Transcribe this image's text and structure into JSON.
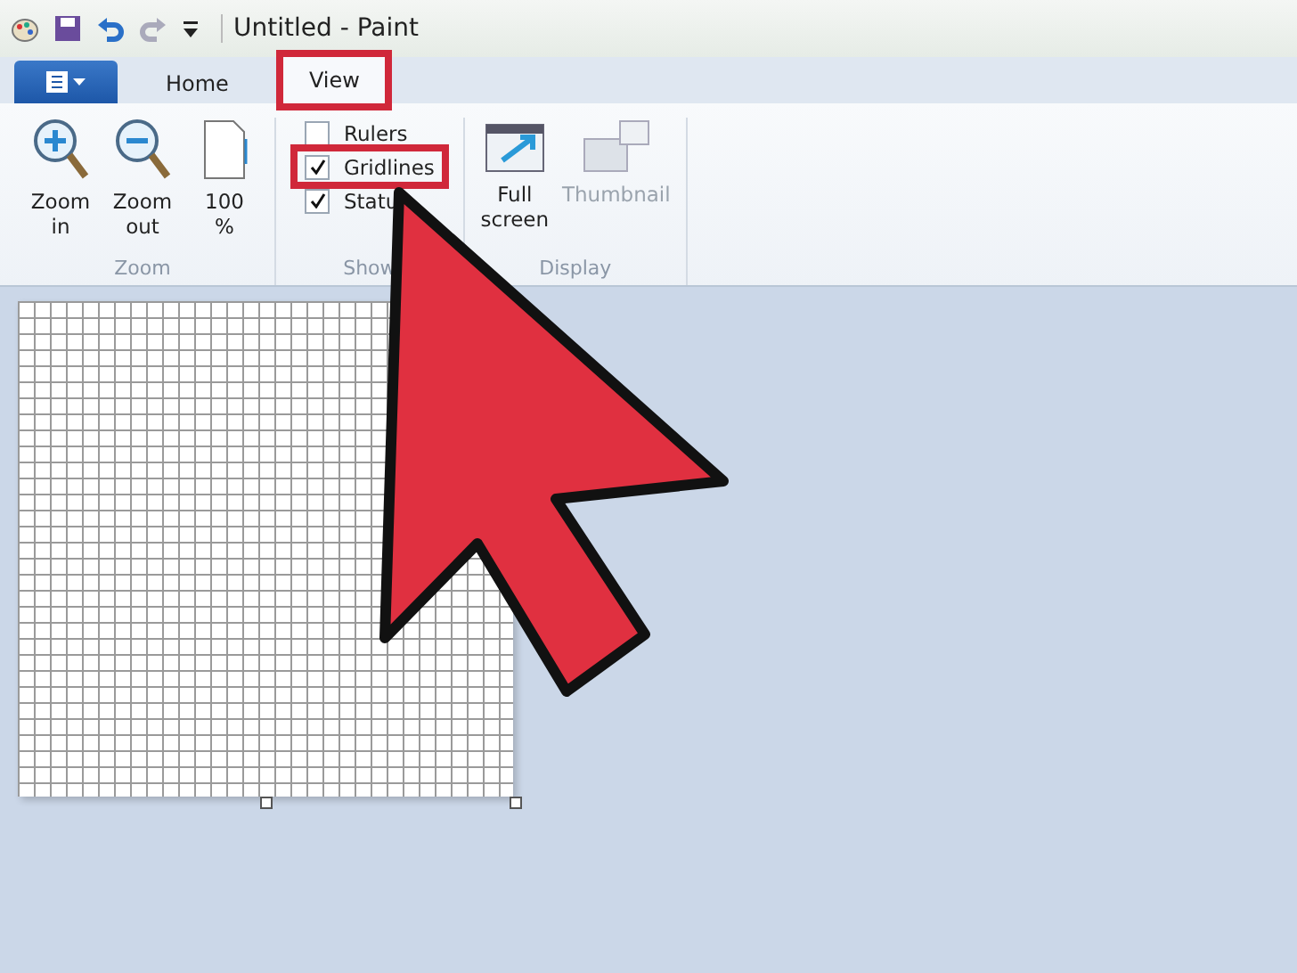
{
  "window": {
    "title": "Untitled - Paint"
  },
  "tabs": [
    {
      "label": "Home",
      "selected": false,
      "highlighted": false
    },
    {
      "label": "View",
      "selected": true,
      "highlighted": true
    }
  ],
  "ribbon": {
    "zoom": {
      "label": "Zoom",
      "buttons": [
        {
          "kind": "zoom-in",
          "label": "Zoom in"
        },
        {
          "kind": "zoom-out",
          "label": "Zoom out"
        },
        {
          "kind": "actual-size",
          "label": "100 %"
        }
      ]
    },
    "show": {
      "label": "Show",
      "options": [
        {
          "label": "Rulers",
          "checked": false,
          "highlighted": false
        },
        {
          "label": "Gridlines",
          "checked": true,
          "highlighted": true
        },
        {
          "label": "Statu",
          "checked": true,
          "highlighted": false
        }
      ]
    },
    "display": {
      "label": "Display",
      "buttons": [
        {
          "kind": "full-screen",
          "label": "Full screen",
          "disabled": false
        },
        {
          "kind": "thumbnail",
          "label": "Thumbnail",
          "disabled": true
        }
      ]
    }
  }
}
